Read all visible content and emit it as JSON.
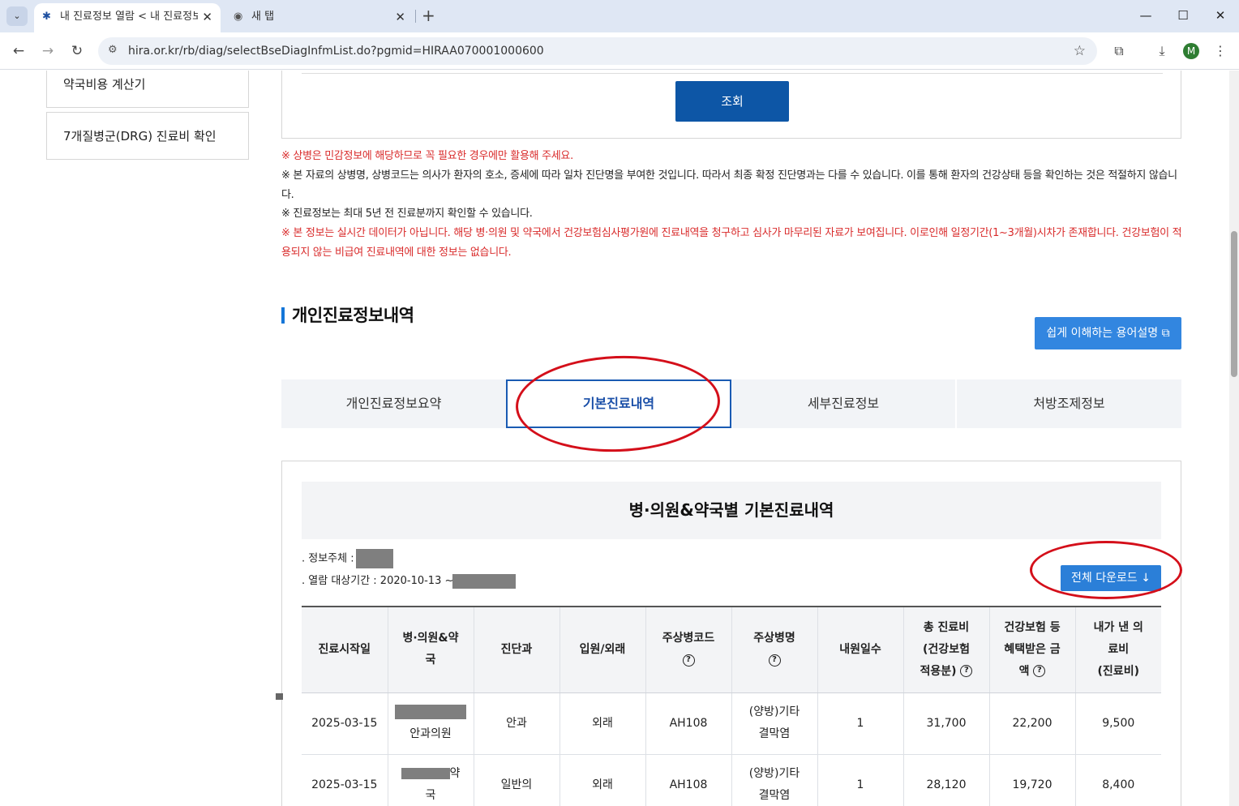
{
  "browser": {
    "tabs": [
      {
        "title": "내 진료정보 열람 < 내 진료정보",
        "active": true
      },
      {
        "title": "새 탭",
        "active": false
      }
    ],
    "url": "hira.or.kr/rb/diag/selectBseDiagInfmList.do?pgmid=HIRAA070001000600",
    "profile_initial": "M"
  },
  "sidebar": {
    "items": [
      {
        "label": "약국비용 계산기"
      },
      {
        "label": "7개질병군(DRG) 진료비 확인"
      }
    ]
  },
  "search": {
    "button_label": "조회"
  },
  "notices": [
    {
      "text": "※ 상병은 민감정보에 해당하므로 꼭 필요한 경우에만 활용해 주세요.",
      "color": "red"
    },
    {
      "text": "※ 본 자료의 상병명, 상병코드는 의사가 환자의 호소, 증세에 따라 일차 진단명을 부여한 것입니다. 따라서 최종 확정 진단명과는 다를 수 있습니다. 이를 통해 환자의 건강상태 등을 확인하는 것은 적절하지 않습니다.",
      "color": "black"
    },
    {
      "text": "※ 진료정보는 최대 5년 전 진료분까지 확인할 수 있습니다.",
      "color": "black"
    },
    {
      "text": "※ 본 정보는 실시간 데이터가 아닙니다. 해당 병·의원 및 약국에서 건강보험심사평가원에 진료내역을 청구하고 심사가 마무리된 자료가 보여집니다. 이로인해 일정기간(1~3개월)시차가 존재합니다. 건강보험이 적용되지 않는 비급여 진료내역에 대한 정보는 없습니다.",
      "color": "red"
    }
  ],
  "section": {
    "title": "개인진료정보내역",
    "terms_button": "쉽게 이해하는 용어설명"
  },
  "page_tabs": [
    {
      "label": "개인진료정보요약",
      "selected": false
    },
    {
      "label": "기본진료내역",
      "selected": true
    },
    {
      "label": "세부진료정보",
      "selected": false
    },
    {
      "label": "처방조제정보",
      "selected": false
    }
  ],
  "content": {
    "heading": "병·의원&약국별 기본진료내역",
    "info_subject_label": ". 정보주체 :",
    "period_label": ". 열람 대상기간 : 2020-10-13 ~",
    "download_button": "전체 다운로드"
  },
  "table": {
    "headers": [
      {
        "lines": [
          "진료시작일"
        ]
      },
      {
        "lines": [
          "병·의원&약",
          "국"
        ]
      },
      {
        "lines": [
          "진단과"
        ]
      },
      {
        "lines": [
          "입원/외래"
        ]
      },
      {
        "lines": [
          "주상병코드"
        ],
        "help": true
      },
      {
        "lines": [
          "주상병명"
        ],
        "help": true
      },
      {
        "lines": [
          "내원일수"
        ]
      },
      {
        "lines": [
          "총 진료비",
          "(건강보험",
          "적용분)"
        ],
        "help": true
      },
      {
        "lines": [
          "건강보험 등",
          "혜택받은 금",
          "액"
        ],
        "help": true
      },
      {
        "lines": [
          "내가 낸 의",
          "료비",
          "(진료비)"
        ]
      }
    ],
    "rows": [
      {
        "date": "2025-03-15",
        "hospital": "안과의원",
        "dept": "안과",
        "type": "외래",
        "code": "AH108",
        "name1": "(양방)기타",
        "name2": "결막염",
        "days": "1",
        "total": "31,700",
        "benefit": "22,200",
        "paid": "9,500"
      },
      {
        "date": "2025-03-15",
        "hospital": "약",
        "hospital2": "국",
        "dept": "일반의",
        "type": "외래",
        "code": "AH108",
        "name1": "(양방)기타",
        "name2": "결막염",
        "days": "1",
        "total": "28,120",
        "benefit": "19,720",
        "paid": "8,400"
      }
    ]
  },
  "colors": {
    "primary_button": "#0d56a6",
    "accent_blue": "#3286e0",
    "notice_red": "#d92b2b",
    "annotation_red": "#d40f1a"
  }
}
